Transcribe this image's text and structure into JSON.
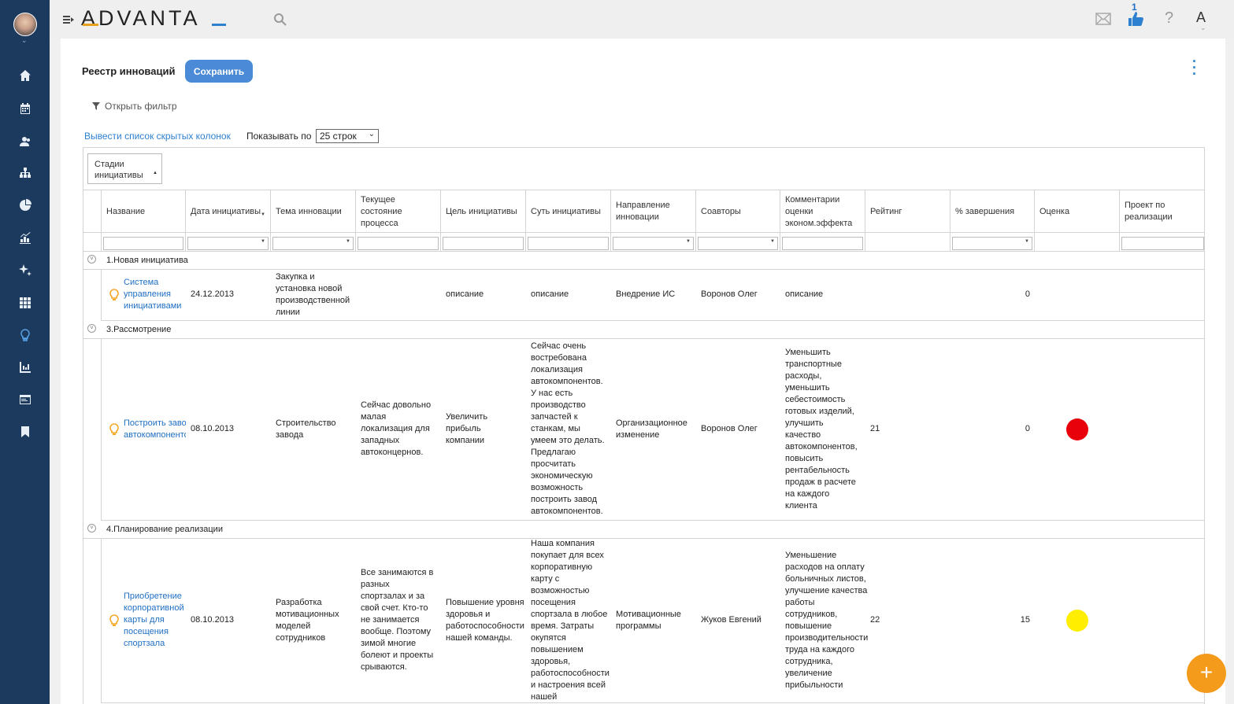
{
  "header": {
    "logo": "ADVANTA",
    "notifications_count": "1",
    "help": "?",
    "account_initial": "A"
  },
  "sidebar": {
    "icons": [
      "home-icon",
      "calendar-icon",
      "people-icon",
      "org-chart-icon",
      "pie-chart-icon",
      "analytics-icon",
      "sparkle-icon",
      "grid-icon",
      "ideas-icon",
      "report-icon",
      "window-icon",
      "bookmark-icon"
    ],
    "active_index": 8
  },
  "page": {
    "title": "Реестр инноваций",
    "save_label": "Сохранить",
    "filter_label": "Открыть фильтр",
    "hidden_cols_link": "Вывести список скрытых колонок",
    "show_by_label": "Показывать по",
    "rows_option": "25 строк",
    "group_by": "Стадии инициативы"
  },
  "columns": [
    "Название",
    "Дата инициативы",
    "Тема инновации",
    "Текущее состояние процесса",
    "Цель инициативы",
    "Суть инициативы",
    "Направление инновации",
    "Соавторы",
    "Комментарии оценки эконом.эффекта",
    "Рейтинг",
    "% завершения",
    "Оценка",
    "Проект по реализации"
  ],
  "groups": [
    {
      "label": "1.Новая инициатива",
      "rows": [
        {
          "name": "Система управления инициативами",
          "date": "24.12.2013",
          "topic": "Закупка и установка новой производственной линии",
          "state": "",
          "goal": "описание",
          "essence": "описание",
          "direction": "Внедрение ИС",
          "coauthors": "Воронов Олег",
          "comments": "описание",
          "rating": "",
          "completion": "0",
          "score_color": "",
          "project": ""
        }
      ]
    },
    {
      "label": "3.Рассмотрение",
      "rows": [
        {
          "name": "Построить завод автокомпонентов",
          "date": "08.10.2013",
          "topic": "Строительство завода",
          "state": "Сейчас довольно малая локализация для западных автоконцернов.",
          "goal": "Увеличить прибыль компании",
          "essence": "Сейчас очень востребована локализация автокомпонентов. У нас есть производство запчастей к станкам, мы умеем это делать. Предлагаю просчитать экономическую возможность построить завод автокомпонентов.",
          "direction": "Организационное изменение",
          "coauthors": "Воронов Олег",
          "comments": "Уменьшить транспортные расходы, уменьшить себестоимость готовых изделий, улучшить качество автокомпонентов, повысить рентабельность продаж в расчете на каждого клиента",
          "rating": "21",
          "completion": "0",
          "score_color": "#e8000b",
          "project": ""
        }
      ]
    },
    {
      "label": "4.Планирование реализации",
      "rows": [
        {
          "name": "Приобретение корпоративной карты для посещения спортзала",
          "date": "08.10.2013",
          "topic": "Разработка мотивационных моделей сотрудников",
          "state": "Все занимаются в разных спортзалах и за свой счет. Кто-то не занимается вообще. Поэтому зимой многие болеют и проекты срываются.",
          "goal": "Повышение уровня здоровья и работоспособности нашей команды.",
          "essence": "Наша компания покупает для всех корпоративную карту с возможностью посещения спортзала в любое время. Затраты окупятся повышением здоровья, работоспособности и настроения всей нашей",
          "direction": "Мотивационные программы",
          "coauthors": "Жуков Евгений",
          "comments": "Уменьшение расходов на оплату больничных листов, улучшение качества работы сотрудников, повышение производительности труда на каждого сотрудника, увеличение прибыльности",
          "rating": "22",
          "completion": "15",
          "score_color": "#ffee00",
          "project": ""
        }
      ]
    }
  ],
  "fab": "+"
}
